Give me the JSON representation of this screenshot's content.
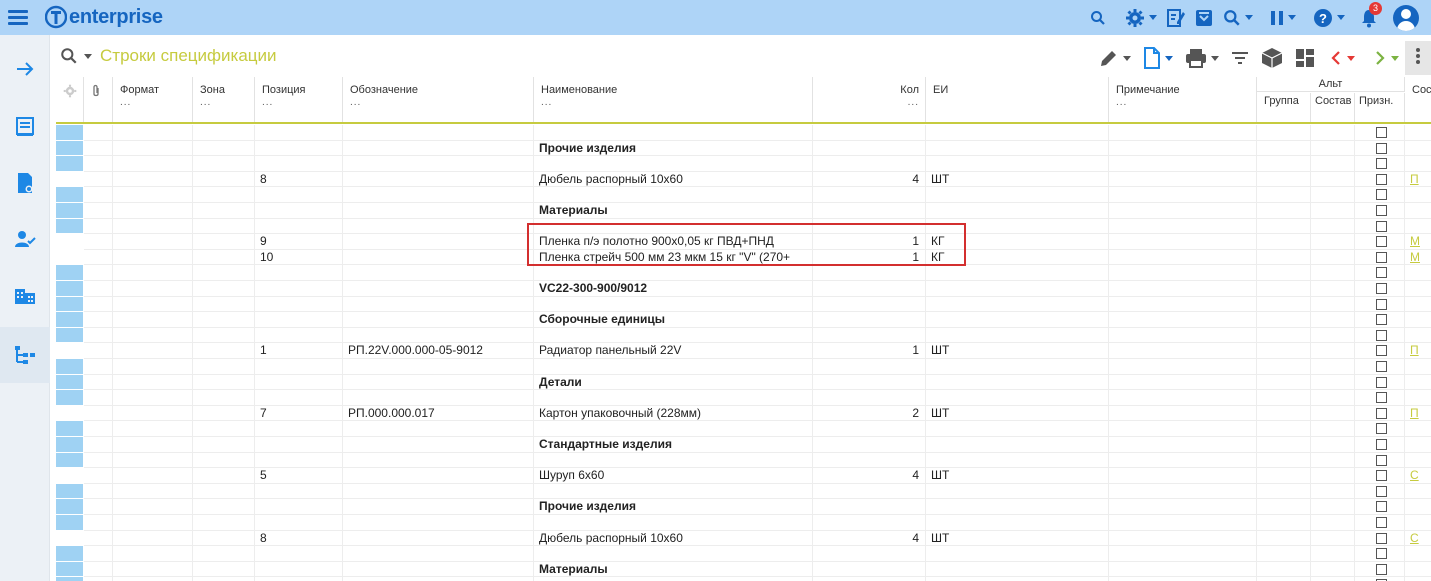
{
  "app": {
    "brand": "enterprise",
    "notifications_count": "3"
  },
  "toolbar": {
    "title": "Строки спецификации"
  },
  "columns": {
    "format": "Формат",
    "zone": "Зона",
    "position": "Позиция",
    "designation": "Обозначение",
    "name": "Наименование",
    "qty": "Кол",
    "unit": "ЕИ",
    "note": "Примечание",
    "alt_group": "Альт",
    "group": "Группа",
    "composition": "Состав",
    "sign": "Призн.",
    "last": "Сос",
    "dots": "..."
  },
  "rows": [
    {
      "pos": "",
      "designation": "",
      "name": "",
      "qty": "",
      "unit": "",
      "bold": false,
      "sel": "b",
      "link": ""
    },
    {
      "pos": "",
      "designation": "",
      "name": "Прочие изделия",
      "qty": "",
      "unit": "",
      "bold": true,
      "sel": "b",
      "link": ""
    },
    {
      "pos": "",
      "designation": "",
      "name": "",
      "qty": "",
      "unit": "",
      "bold": false,
      "sel": "b",
      "link": ""
    },
    {
      "pos": "8",
      "designation": "",
      "name": "Дюбель распорный 10х60",
      "qty": "4",
      "unit": "ШТ",
      "bold": false,
      "sel": "w",
      "link": "П"
    },
    {
      "pos": "",
      "designation": "",
      "name": "",
      "qty": "",
      "unit": "",
      "bold": false,
      "sel": "b",
      "link": ""
    },
    {
      "pos": "",
      "designation": "",
      "name": "Материалы",
      "qty": "",
      "unit": "",
      "bold": true,
      "sel": "b",
      "link": ""
    },
    {
      "pos": "",
      "designation": "",
      "name": "",
      "qty": "",
      "unit": "",
      "bold": false,
      "sel": "b",
      "link": ""
    },
    {
      "pos": "9",
      "designation": "",
      "name": "Пленка п/э полотно 900х0,05 кг ПВД+ПНД",
      "qty": "1",
      "unit": "КГ",
      "bold": false,
      "sel": "w",
      "link": "М"
    },
    {
      "pos": "10",
      "designation": "",
      "name": "Пленка стрейч 500 мм 23 мкм 15 кг \"V\" (270+",
      "qty": "1",
      "unit": "КГ",
      "bold": false,
      "sel": "w",
      "link": "М"
    },
    {
      "pos": "",
      "designation": "",
      "name": "",
      "qty": "",
      "unit": "",
      "bold": false,
      "sel": "b",
      "link": ""
    },
    {
      "pos": "",
      "designation": "",
      "name": "VC22-300-900/9012",
      "qty": "",
      "unit": "",
      "bold": true,
      "sel": "b",
      "link": ""
    },
    {
      "pos": "",
      "designation": "",
      "name": "",
      "qty": "",
      "unit": "",
      "bold": false,
      "sel": "b",
      "link": ""
    },
    {
      "pos": "",
      "designation": "",
      "name": "Сборочные единицы",
      "qty": "",
      "unit": "",
      "bold": true,
      "sel": "b",
      "link": ""
    },
    {
      "pos": "",
      "designation": "",
      "name": "",
      "qty": "",
      "unit": "",
      "bold": false,
      "sel": "b",
      "link": ""
    },
    {
      "pos": "1",
      "designation": "РП.22V.000.000-05-9012",
      "name": "Радиатор панельный 22V",
      "qty": "1",
      "unit": "ШТ",
      "bold": false,
      "sel": "w",
      "link": "П"
    },
    {
      "pos": "",
      "designation": "",
      "name": "",
      "qty": "",
      "unit": "",
      "bold": false,
      "sel": "b",
      "link": ""
    },
    {
      "pos": "",
      "designation": "",
      "name": "Детали",
      "qty": "",
      "unit": "",
      "bold": true,
      "sel": "b",
      "link": ""
    },
    {
      "pos": "",
      "designation": "",
      "name": "",
      "qty": "",
      "unit": "",
      "bold": false,
      "sel": "b",
      "link": ""
    },
    {
      "pos": "7",
      "designation": "РП.000.000.017",
      "name": "Картон упаковочный (228мм)",
      "qty": "2",
      "unit": "ШТ",
      "bold": false,
      "sel": "w",
      "link": "П"
    },
    {
      "pos": "",
      "designation": "",
      "name": "",
      "qty": "",
      "unit": "",
      "bold": false,
      "sel": "b",
      "link": ""
    },
    {
      "pos": "",
      "designation": "",
      "name": "Стандартные изделия",
      "qty": "",
      "unit": "",
      "bold": true,
      "sel": "b",
      "link": ""
    },
    {
      "pos": "",
      "designation": "",
      "name": "",
      "qty": "",
      "unit": "",
      "bold": false,
      "sel": "b",
      "link": ""
    },
    {
      "pos": "5",
      "designation": "",
      "name": "Шуруп 6х60",
      "qty": "4",
      "unit": "ШТ",
      "bold": false,
      "sel": "w",
      "link": "С"
    },
    {
      "pos": "",
      "designation": "",
      "name": "",
      "qty": "",
      "unit": "",
      "bold": false,
      "sel": "b",
      "link": ""
    },
    {
      "pos": "",
      "designation": "",
      "name": "Прочие изделия",
      "qty": "",
      "unit": "",
      "bold": true,
      "sel": "b",
      "link": ""
    },
    {
      "pos": "",
      "designation": "",
      "name": "",
      "qty": "",
      "unit": "",
      "bold": false,
      "sel": "b",
      "link": ""
    },
    {
      "pos": "8",
      "designation": "",
      "name": "Дюбель распорный 10х60",
      "qty": "4",
      "unit": "ШТ",
      "bold": false,
      "sel": "w",
      "link": "С"
    },
    {
      "pos": "",
      "designation": "",
      "name": "",
      "qty": "",
      "unit": "",
      "bold": false,
      "sel": "b",
      "link": ""
    },
    {
      "pos": "",
      "designation": "",
      "name": "Материалы",
      "qty": "",
      "unit": "",
      "bold": true,
      "sel": "b",
      "link": ""
    },
    {
      "pos": "",
      "designation": "",
      "name": "",
      "qty": "",
      "unit": "",
      "bold": false,
      "sel": "b",
      "link": ""
    }
  ],
  "colors": {
    "accent": "#1565c0",
    "title": "#c6cb3f",
    "selection": "#9fd2f3",
    "highlight": "#d32f2f"
  }
}
